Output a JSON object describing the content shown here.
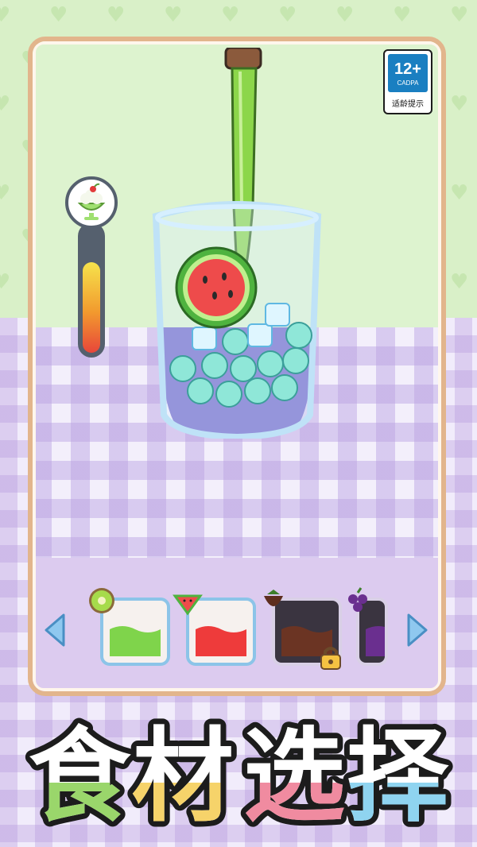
{
  "age_rating": {
    "number": "12+",
    "org": "CADPA",
    "label": "适龄提示",
    "color": "#1a7fc1"
  },
  "thermometer": {
    "level": 0.72,
    "icon": "ice-cream-sundae-icon"
  },
  "cup": {
    "contents": [
      "watermelon-slice",
      "ice-cubes",
      "tapioca-pearls",
      "purple-juice"
    ]
  },
  "ingredients": [
    {
      "name": "kiwi",
      "icon": "kiwi-icon",
      "juice_color": "#7fd44b",
      "locked": false,
      "selected": true
    },
    {
      "name": "watermelon",
      "icon": "watermelon-icon",
      "juice_color": "#ee3b3b",
      "locked": false,
      "selected": true
    },
    {
      "name": "chocolate-strawberry",
      "icon": "strawberry-icon",
      "juice_color": "#6b3423",
      "locked": true,
      "selected": false
    },
    {
      "name": "grape",
      "icon": "grape-icon",
      "juice_color": "#6a2f8f",
      "locked": true,
      "selected": false
    }
  ],
  "title": {
    "chars": [
      "食",
      "材",
      "选",
      "择"
    ],
    "colors": [
      "#9ad66b",
      "#f6d36a",
      "#f08ba0",
      "#8fd4f0"
    ]
  },
  "nav": {
    "prev": "chevron-left-icon",
    "next": "chevron-right-icon"
  }
}
